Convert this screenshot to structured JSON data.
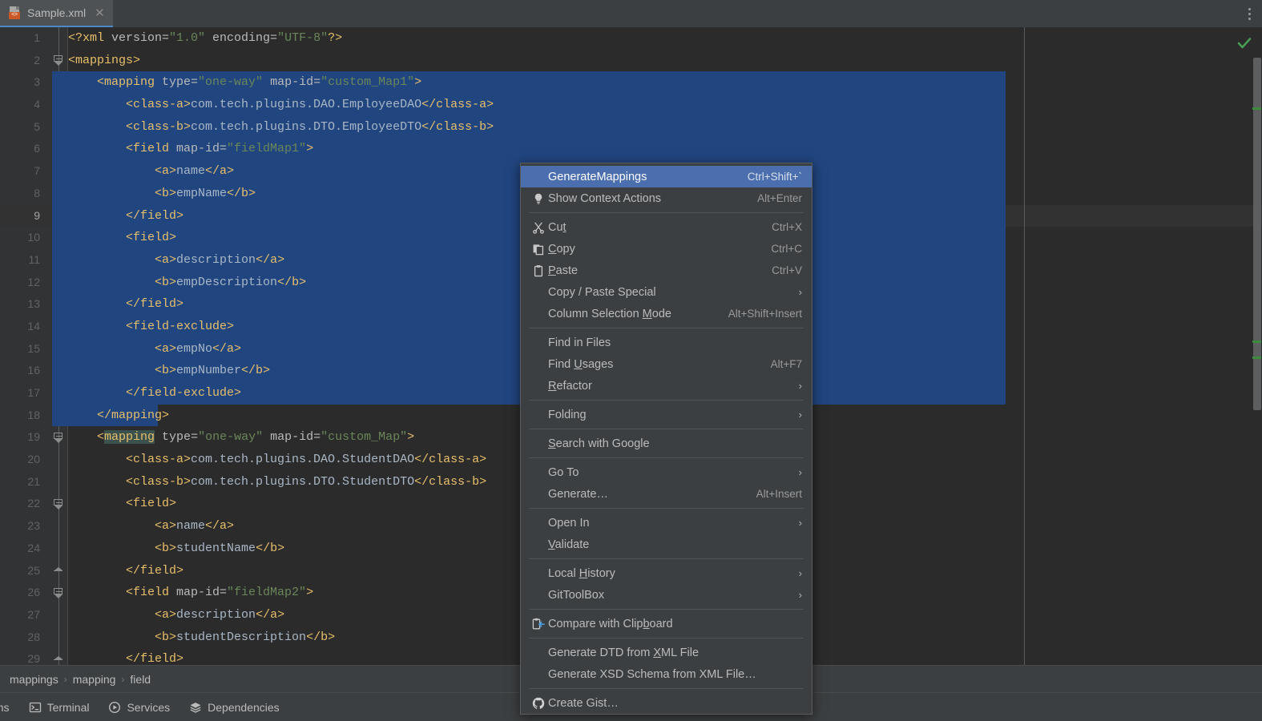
{
  "window": {
    "tab": {
      "label": "Sample.xml",
      "icon": "xml-file-icon",
      "close_icon": "close-icon"
    },
    "tab_actions_icon": "more-vertical-icon"
  },
  "editor": {
    "inspection_status_icon": "checkmark-ok-icon",
    "lines": [
      {
        "n": "1",
        "indent": 0,
        "sel": 0,
        "tokens": [
          {
            "c": "t-tag",
            "t": "<?xml "
          },
          {
            "c": "t-attr",
            "t": "version="
          },
          {
            "c": "t-val",
            "t": "\"1.0\""
          },
          {
            "c": "t-attr",
            "t": " encoding="
          },
          {
            "c": "t-val",
            "t": "\"UTF-8\""
          },
          {
            "c": "t-tag",
            "t": "?>"
          }
        ]
      },
      {
        "n": "2",
        "indent": 0,
        "sel": 0,
        "fold": "start",
        "tokens": [
          {
            "c": "t-tag",
            "t": "<mappings>"
          }
        ]
      },
      {
        "n": "3",
        "indent": 0,
        "sel": 1190,
        "fold": "start",
        "tokens": [
          {
            "c": "t-tag",
            "t": "    <mapping "
          },
          {
            "c": "t-attr",
            "t": "type="
          },
          {
            "c": "t-val",
            "t": "\"one-way\""
          },
          {
            "c": "t-attr",
            "t": " map-id="
          },
          {
            "c": "t-val",
            "t": "\"custom_Map1\""
          },
          {
            "c": "t-tag",
            "t": ">"
          }
        ]
      },
      {
        "n": "4",
        "indent": 0,
        "sel": 1190,
        "tokens": [
          {
            "c": "t-tag",
            "t": "        <class-a>"
          },
          {
            "c": "t-txt",
            "t": "com.tech.plugins.DAO.EmployeeDAO"
          },
          {
            "c": "t-tag",
            "t": "</class-a>"
          }
        ]
      },
      {
        "n": "5",
        "indent": 0,
        "sel": 1190,
        "tokens": [
          {
            "c": "t-tag",
            "t": "        <class-b>"
          },
          {
            "c": "t-txt",
            "t": "com.tech.plugins.DTO.EmployeeDTO"
          },
          {
            "c": "t-tag",
            "t": "</class-b>"
          }
        ]
      },
      {
        "n": "6",
        "indent": 0,
        "sel": 1190,
        "fold": "start",
        "tokens": [
          {
            "c": "t-tag",
            "t": "        <field "
          },
          {
            "c": "t-attr",
            "t": "map-id="
          },
          {
            "c": "t-val",
            "t": "\"fieldMap1\""
          },
          {
            "c": "t-tag",
            "t": ">"
          }
        ]
      },
      {
        "n": "7",
        "indent": 0,
        "sel": 1190,
        "tokens": [
          {
            "c": "t-tag",
            "t": "            <a>"
          },
          {
            "c": "t-txt",
            "t": "name"
          },
          {
            "c": "t-tag",
            "t": "</a>"
          }
        ]
      },
      {
        "n": "8",
        "indent": 0,
        "sel": 1190,
        "tokens": [
          {
            "c": "t-tag",
            "t": "            <b>"
          },
          {
            "c": "t-txt",
            "t": "empName"
          },
          {
            "c": "t-tag",
            "t": "</b>"
          }
        ]
      },
      {
        "n": "9",
        "indent": 0,
        "sel": 1190,
        "fold": "end",
        "current": true,
        "tokens": [
          {
            "c": "t-tag",
            "t": "        </field>"
          }
        ]
      },
      {
        "n": "10",
        "indent": 0,
        "sel": 1190,
        "fold": "start",
        "tokens": [
          {
            "c": "t-tag",
            "t": "        <field>"
          }
        ]
      },
      {
        "n": "11",
        "indent": 0,
        "sel": 1190,
        "tokens": [
          {
            "c": "t-tag",
            "t": "            <a>"
          },
          {
            "c": "t-txt",
            "t": "description"
          },
          {
            "c": "t-tag",
            "t": "</a>"
          }
        ]
      },
      {
        "n": "12",
        "indent": 0,
        "sel": 1190,
        "tokens": [
          {
            "c": "t-tag",
            "t": "            <b>"
          },
          {
            "c": "t-txt",
            "t": "empDescription"
          },
          {
            "c": "t-tag",
            "t": "</b>"
          }
        ]
      },
      {
        "n": "13",
        "indent": 0,
        "sel": 1190,
        "fold": "end",
        "tokens": [
          {
            "c": "t-tag",
            "t": "        </field>"
          }
        ]
      },
      {
        "n": "14",
        "indent": 0,
        "sel": 1190,
        "fold": "start",
        "tokens": [
          {
            "c": "t-tag",
            "t": "        <field-exclude>"
          }
        ]
      },
      {
        "n": "15",
        "indent": 0,
        "sel": 1190,
        "tokens": [
          {
            "c": "t-tag",
            "t": "            <a>"
          },
          {
            "c": "t-txt",
            "t": "empNo"
          },
          {
            "c": "t-tag",
            "t": "</a>"
          }
        ]
      },
      {
        "n": "16",
        "indent": 0,
        "sel": 1190,
        "tokens": [
          {
            "c": "t-tag",
            "t": "            <b>"
          },
          {
            "c": "t-txt",
            "t": "empNumber"
          },
          {
            "c": "t-tag",
            "t": "</b>"
          }
        ]
      },
      {
        "n": "17",
        "indent": 0,
        "sel": 1190,
        "fold": "end",
        "tokens": [
          {
            "c": "t-tag",
            "t": "        </field-exclude>"
          }
        ]
      },
      {
        "n": "18",
        "indent": 0,
        "sel": 132,
        "fold": "end",
        "tokens": [
          {
            "c": "t-tag",
            "t": "    </mapping>"
          }
        ]
      },
      {
        "n": "19",
        "indent": 0,
        "sel": 0,
        "fold": "start",
        "tokens": [
          {
            "c": "t-tag",
            "t": "    <"
          },
          {
            "c": "t-tag t-hl",
            "t": "mapping"
          },
          {
            "c": "t-tag",
            "t": " "
          },
          {
            "c": "t-attr",
            "t": "type="
          },
          {
            "c": "t-val",
            "t": "\"one-way\""
          },
          {
            "c": "t-attr",
            "t": " map-id="
          },
          {
            "c": "t-val",
            "t": "\"custom_Map\""
          },
          {
            "c": "t-tag",
            "t": ">"
          }
        ]
      },
      {
        "n": "20",
        "indent": 0,
        "sel": 0,
        "tokens": [
          {
            "c": "t-tag",
            "t": "        <class-a>"
          },
          {
            "c": "t-txt",
            "t": "com.tech.plugins.DAO.StudentDAO"
          },
          {
            "c": "t-tag",
            "t": "</class-a>"
          }
        ]
      },
      {
        "n": "21",
        "indent": 0,
        "sel": 0,
        "tokens": [
          {
            "c": "t-tag",
            "t": "        <class-b>"
          },
          {
            "c": "t-txt",
            "t": "com.tech.plugins.DTO.StudentDTO"
          },
          {
            "c": "t-tag",
            "t": "</class-b>"
          }
        ]
      },
      {
        "n": "22",
        "indent": 0,
        "sel": 0,
        "fold": "start",
        "tokens": [
          {
            "c": "t-tag",
            "t": "        <field>"
          }
        ]
      },
      {
        "n": "23",
        "indent": 0,
        "sel": 0,
        "tokens": [
          {
            "c": "t-tag",
            "t": "            <a>"
          },
          {
            "c": "t-txt",
            "t": "name"
          },
          {
            "c": "t-tag",
            "t": "</a>"
          }
        ]
      },
      {
        "n": "24",
        "indent": 0,
        "sel": 0,
        "tokens": [
          {
            "c": "t-tag",
            "t": "            <b>"
          },
          {
            "c": "t-txt",
            "t": "studentName"
          },
          {
            "c": "t-tag",
            "t": "</b>"
          }
        ]
      },
      {
        "n": "25",
        "indent": 0,
        "sel": 0,
        "fold": "end",
        "tokens": [
          {
            "c": "t-tag",
            "t": "        </field>"
          }
        ]
      },
      {
        "n": "26",
        "indent": 0,
        "sel": 0,
        "fold": "start",
        "tokens": [
          {
            "c": "t-tag",
            "t": "        <field "
          },
          {
            "c": "t-attr",
            "t": "map-id="
          },
          {
            "c": "t-val",
            "t": "\"fieldMap2\""
          },
          {
            "c": "t-tag",
            "t": ">"
          }
        ]
      },
      {
        "n": "27",
        "indent": 0,
        "sel": 0,
        "tokens": [
          {
            "c": "t-tag",
            "t": "            <a>"
          },
          {
            "c": "t-txt",
            "t": "description"
          },
          {
            "c": "t-tag",
            "t": "</a>"
          }
        ]
      },
      {
        "n": "28",
        "indent": 0,
        "sel": 0,
        "tokens": [
          {
            "c": "t-tag",
            "t": "            <b>"
          },
          {
            "c": "t-txt",
            "t": "studentDescription"
          },
          {
            "c": "t-tag",
            "t": "</b>"
          }
        ]
      },
      {
        "n": "29",
        "indent": 0,
        "sel": 0,
        "fold": "end",
        "tokens": [
          {
            "c": "t-tag",
            "t": "        </field>"
          }
        ]
      }
    ]
  },
  "context_menu": {
    "items": [
      {
        "kind": "item",
        "label": "GenerateMappings",
        "shortcut": "Ctrl+Shift+`",
        "icon": null,
        "arrow": false,
        "highlighted": true,
        "name": "menu-item-generate-mappings"
      },
      {
        "kind": "item",
        "label": "Show Context Actions",
        "shortcut": "Alt+Enter",
        "icon": "lightbulb-icon",
        "arrow": false,
        "name": "menu-item-show-context-actions"
      },
      {
        "kind": "sep"
      },
      {
        "kind": "item",
        "label": "Cut",
        "mnemonic": "t",
        "shortcut": "Ctrl+X",
        "icon": "scissors-icon",
        "arrow": false,
        "name": "menu-item-cut"
      },
      {
        "kind": "item",
        "label": "Copy",
        "mnemonic": "C",
        "shortcut": "Ctrl+C",
        "icon": "copy-icon",
        "arrow": false,
        "name": "menu-item-copy"
      },
      {
        "kind": "item",
        "label": "Paste",
        "mnemonic": "P",
        "shortcut": "Ctrl+V",
        "icon": "clipboard-icon",
        "arrow": false,
        "name": "menu-item-paste"
      },
      {
        "kind": "item",
        "label": "Copy / Paste Special",
        "shortcut": "",
        "icon": null,
        "arrow": true,
        "name": "menu-item-copy-paste-special"
      },
      {
        "kind": "item",
        "label": "Column Selection Mode",
        "mnemonic": "M",
        "shortcut": "Alt+Shift+Insert",
        "icon": null,
        "arrow": false,
        "name": "menu-item-column-selection-mode"
      },
      {
        "kind": "sep"
      },
      {
        "kind": "item",
        "label": "Find in Files",
        "shortcut": "",
        "icon": null,
        "arrow": false,
        "name": "menu-item-find-in-files"
      },
      {
        "kind": "item",
        "label": "Find Usages",
        "mnemonic": "U",
        "shortcut": "Alt+F7",
        "icon": null,
        "arrow": false,
        "name": "menu-item-find-usages"
      },
      {
        "kind": "item",
        "label": "Refactor",
        "mnemonic": "R",
        "shortcut": "",
        "icon": null,
        "arrow": true,
        "name": "menu-item-refactor"
      },
      {
        "kind": "sep"
      },
      {
        "kind": "item",
        "label": "Folding",
        "shortcut": "",
        "icon": null,
        "arrow": true,
        "name": "menu-item-folding"
      },
      {
        "kind": "sep"
      },
      {
        "kind": "item",
        "label": "Search with Google",
        "mnemonic": "S",
        "shortcut": "",
        "icon": null,
        "arrow": false,
        "name": "menu-item-search-with-google"
      },
      {
        "kind": "sep"
      },
      {
        "kind": "item",
        "label": "Go To",
        "shortcut": "",
        "icon": null,
        "arrow": true,
        "name": "menu-item-go-to"
      },
      {
        "kind": "item",
        "label": "Generate…",
        "shortcut": "Alt+Insert",
        "icon": null,
        "arrow": false,
        "name": "menu-item-generate"
      },
      {
        "kind": "sep"
      },
      {
        "kind": "item",
        "label": "Open In",
        "shortcut": "",
        "icon": null,
        "arrow": true,
        "name": "menu-item-open-in"
      },
      {
        "kind": "item",
        "label": "Validate",
        "mnemonic": "V",
        "shortcut": "",
        "icon": null,
        "arrow": false,
        "name": "menu-item-validate"
      },
      {
        "kind": "sep"
      },
      {
        "kind": "item",
        "label": "Local History",
        "mnemonic": "H",
        "shortcut": "",
        "icon": null,
        "arrow": true,
        "name": "menu-item-local-history"
      },
      {
        "kind": "item",
        "label": "GitToolBox",
        "shortcut": "",
        "icon": null,
        "arrow": true,
        "name": "menu-item-gittoolbox"
      },
      {
        "kind": "sep"
      },
      {
        "kind": "item",
        "label": "Compare with Clipboard",
        "mnemonic": "b",
        "shortcut": "",
        "icon": "compare-clipboard-icon",
        "arrow": false,
        "name": "menu-item-compare-with-clipboard"
      },
      {
        "kind": "sep"
      },
      {
        "kind": "item",
        "label": "Generate DTD from XML File",
        "mnemonic": "X",
        "shortcut": "",
        "icon": null,
        "arrow": false,
        "name": "menu-item-generate-dtd"
      },
      {
        "kind": "item",
        "label": "Generate XSD Schema from XML File…",
        "shortcut": "",
        "icon": null,
        "arrow": false,
        "name": "menu-item-generate-xsd"
      },
      {
        "kind": "sep"
      },
      {
        "kind": "item",
        "label": "Create Gist…",
        "shortcut": "",
        "icon": "github-icon",
        "arrow": false,
        "name": "menu-item-create-gist"
      }
    ]
  },
  "breadcrumb": {
    "items": [
      "mappings",
      "mapping",
      "field"
    ],
    "separator": "›"
  },
  "statusbar": {
    "items": [
      {
        "label": "lems",
        "icon": null,
        "name": "status-item-problems"
      },
      {
        "label": "Terminal",
        "icon": "terminal-icon",
        "name": "status-item-terminal"
      },
      {
        "label": "Services",
        "icon": "play-circle-icon",
        "name": "status-item-services"
      },
      {
        "label": "Dependencies",
        "icon": "layers-icon",
        "name": "status-item-dependencies"
      }
    ]
  },
  "colors": {
    "selection": "#21457F",
    "menu_highlight": "#4B6EAF",
    "tag": "#E8BF6A",
    "attr_value": "#6A8759",
    "text": "#A9B7C6",
    "ok_green": "#499C54",
    "tab_underline": "#4A88C7"
  }
}
